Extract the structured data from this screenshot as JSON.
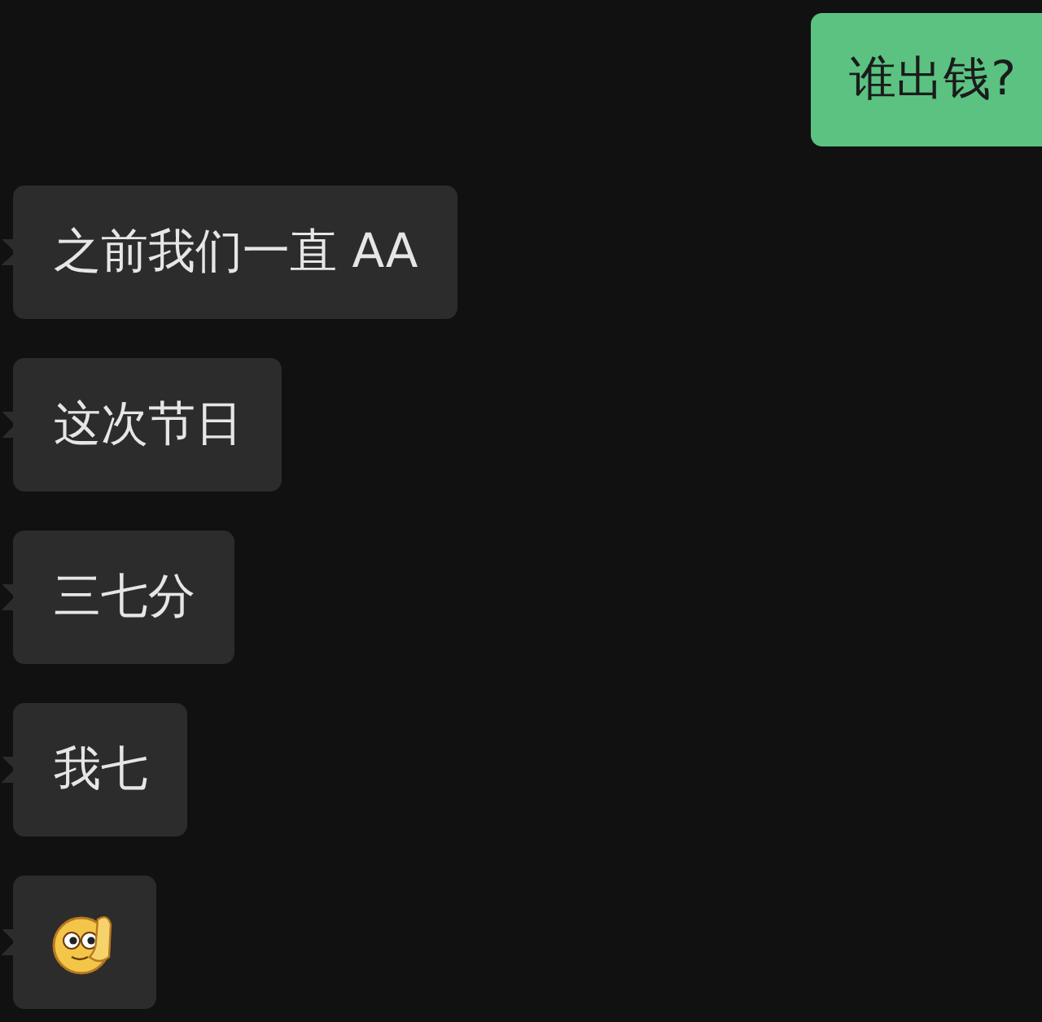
{
  "messages": [
    {
      "outgoing": true,
      "kind": "text",
      "text": "谁出钱?"
    },
    {
      "outgoing": false,
      "kind": "text",
      "text": "之前我们一直 AA"
    },
    {
      "outgoing": false,
      "kind": "text",
      "text": "这次节日"
    },
    {
      "outgoing": false,
      "kind": "text",
      "text": "三七分"
    },
    {
      "outgoing": false,
      "kind": "text",
      "text": "我七"
    },
    {
      "outgoing": false,
      "kind": "emoji"
    }
  ]
}
